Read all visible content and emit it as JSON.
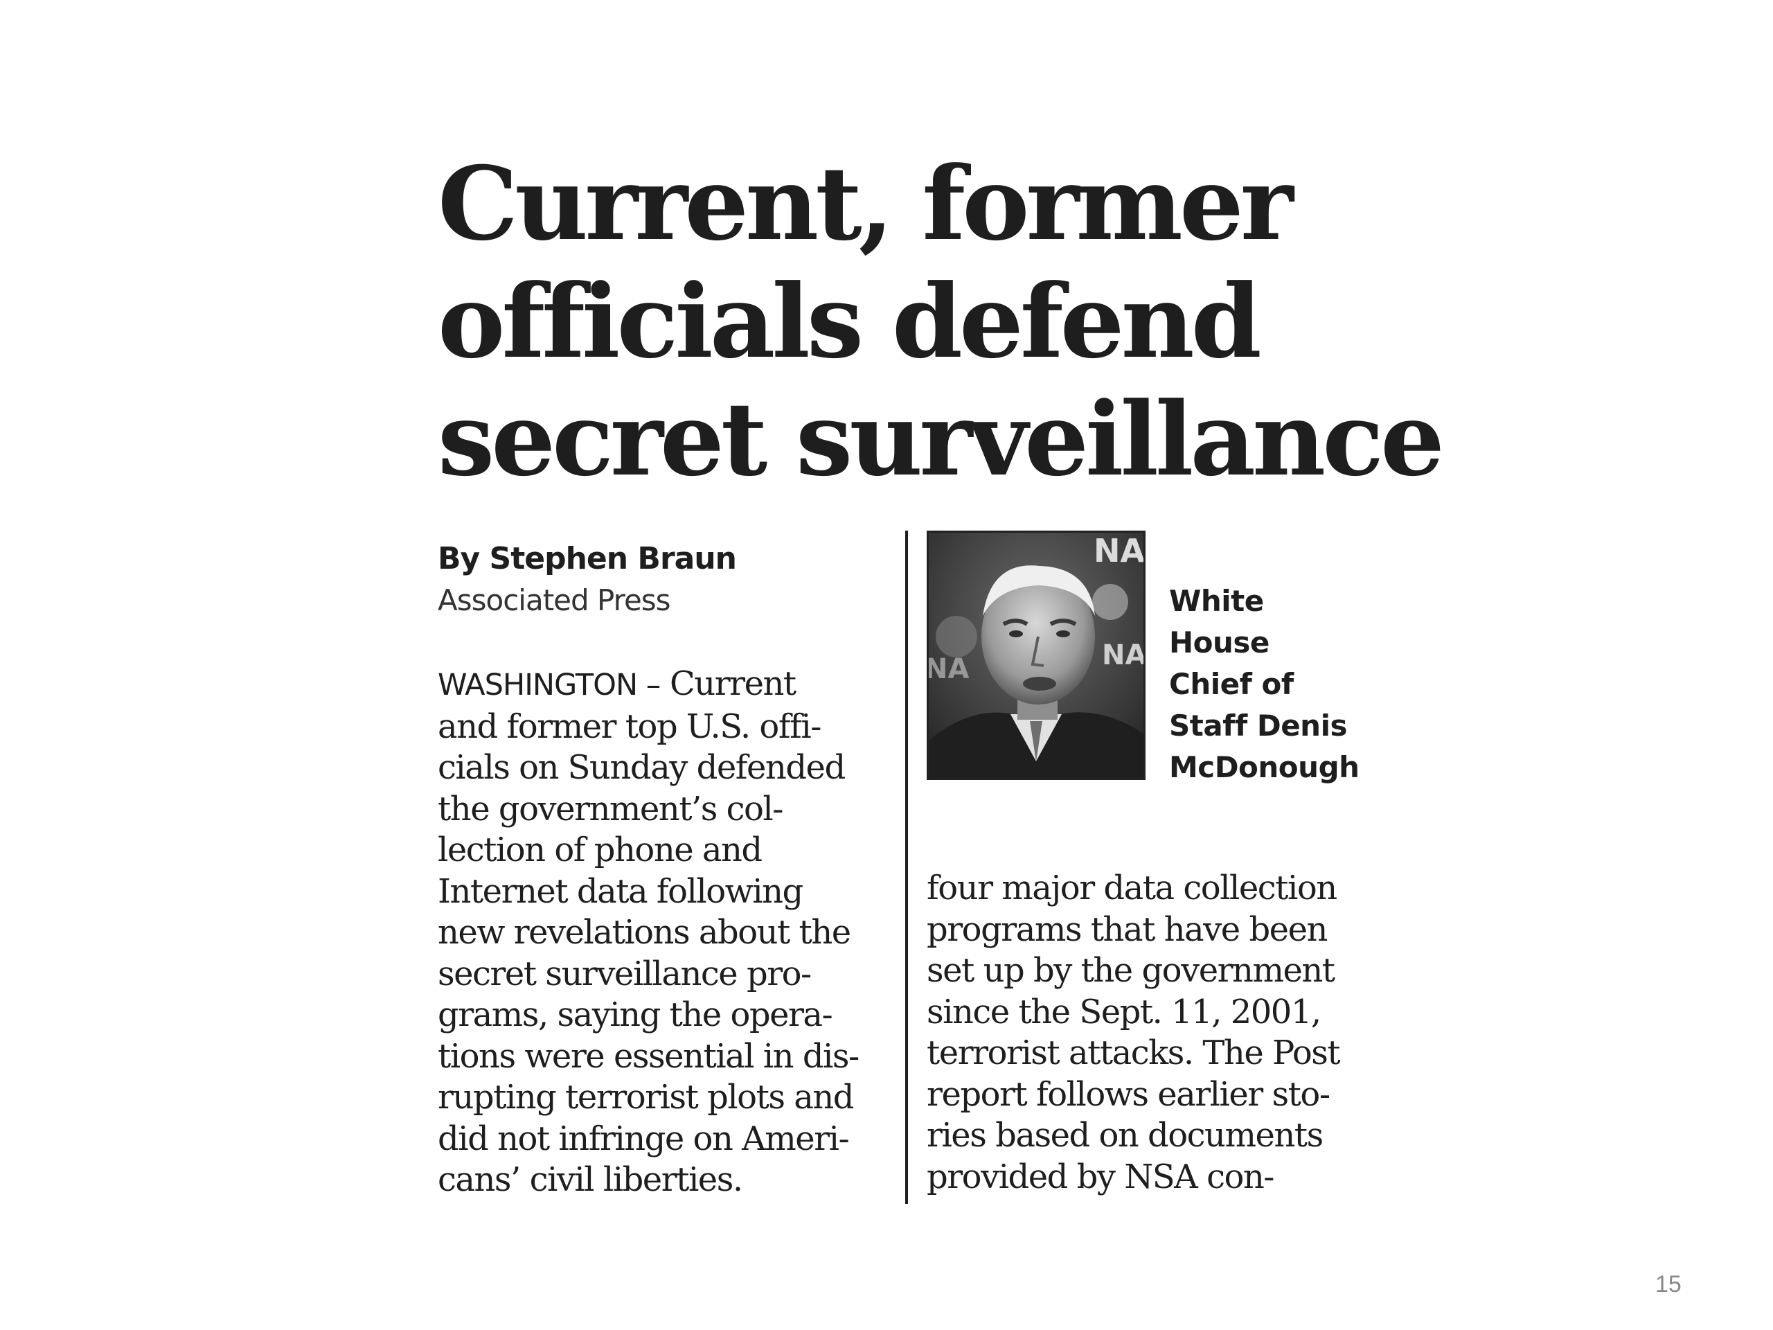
{
  "article": {
    "headline_lines": [
      "Current, former",
      "officials defend",
      "secret surveillance"
    ],
    "byline": "By Stephen Braun",
    "agency": "Associated Press",
    "dateline": "WASHINGTON –",
    "left_column_first_line_rest": " Current",
    "left_column_lines": [
      "and former top U.S. offi-",
      "cials on Sunday defended",
      "the government’s col-",
      "lection of phone and",
      "Internet data following",
      "new revelations about the",
      "secret surveillance pro-",
      "grams, saying the opera-",
      "tions were essential in dis-",
      "rupting terrorist plots and",
      "did not infringe on Ameri-",
      "cans’ civil liberties."
    ],
    "right_column_lines": [
      "four major data collection",
      "programs that have been",
      "set up by the government",
      "since the Sept. 11, 2001,",
      "terrorist attacks. The Post",
      "report follows earlier sto-",
      "ries based on documents",
      "provided by NSA con-"
    ],
    "photo": {
      "background_text": "NA"
    },
    "caption_lines": [
      "White",
      "House",
      "Chief of",
      "Staff Denis",
      "McDonough"
    ]
  },
  "slide": {
    "page_number": "15"
  },
  "colors": {
    "text": "#1e1e1e",
    "page_number": "#888888",
    "background": "#ffffff"
  }
}
